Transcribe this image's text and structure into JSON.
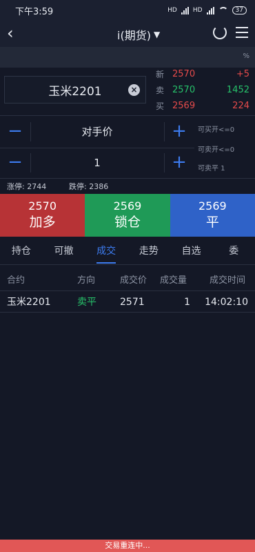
{
  "status": {
    "time": "下午3:59",
    "sig1": "HD",
    "sig2": "HD",
    "battery": "37"
  },
  "nav": {
    "title": "i(期货)",
    "dropdown": "▼",
    "back": "‹"
  },
  "subbar": {
    "pct": "%"
  },
  "symbol": {
    "value": "玉米2201",
    "clear": "×"
  },
  "quote": [
    {
      "label": "新",
      "price": "2570",
      "value": "+5",
      "price_color": "red",
      "value_color": "red"
    },
    {
      "label": "卖",
      "price": "2570",
      "value": "1452",
      "price_color": "green",
      "value_color": "green"
    },
    {
      "label": "买",
      "price": "2569",
      "value": "224",
      "price_color": "red",
      "value_color": "red"
    }
  ],
  "price_stepper": {
    "value": "对手价",
    "minus": "−",
    "plus": "+"
  },
  "qty_stepper": {
    "value": "1",
    "minus": "−",
    "plus": "+"
  },
  "hints": {
    "open_buy": "可买开<=0",
    "open_sell": "可卖开<=0",
    "close_sell": "可卖平 1"
  },
  "limits": {
    "up": "涨停: 2744",
    "down": "跌停: 2386"
  },
  "actions": [
    {
      "price": "2570",
      "label": "加多"
    },
    {
      "price": "2569",
      "label": "锁仓"
    },
    {
      "price": "2569",
      "label": "平"
    }
  ],
  "tabs": [
    "持仓",
    "可撤",
    "成交",
    "走势",
    "自选",
    "委"
  ],
  "active_tab": 2,
  "table": {
    "headers": [
      "合约",
      "方向",
      "成交价",
      "成交量",
      "成交时间"
    ],
    "rows": [
      [
        "玉米2201",
        "卖平",
        "2571",
        "1",
        "14:02:10"
      ]
    ]
  },
  "bottom": {
    "message": "交易重连中..."
  },
  "colors": {
    "red": "#e74b4b",
    "green": "#27c36b",
    "blue": "#3d7cf0"
  }
}
